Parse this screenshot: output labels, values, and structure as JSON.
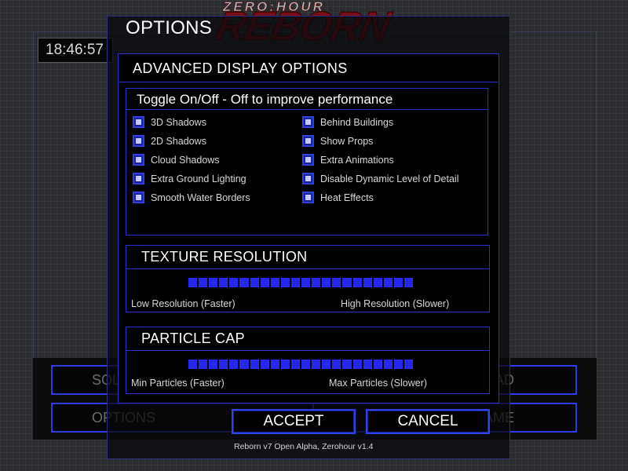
{
  "background_menu": {
    "clock": "18:46:57",
    "buttons": [
      {
        "label": "SOLO PLAY"
      },
      {
        "label": "LOAD"
      },
      {
        "label": "OPTIONS"
      },
      {
        "label": "EXIT GAME"
      }
    ]
  },
  "logo": {
    "top": "ZERO:HOUR",
    "main": "REBORN"
  },
  "dialog": {
    "title": "OPTIONS",
    "advanced_title": "ADVANCED DISPLAY OPTIONS",
    "toggle_section": {
      "title": "Toggle On/Off - Off to improve performance",
      "left_items": [
        {
          "label": "3D Shadows",
          "checked": true
        },
        {
          "label": "2D Shadows",
          "checked": true
        },
        {
          "label": "Cloud Shadows",
          "checked": true
        },
        {
          "label": "Extra Ground Lighting",
          "checked": true
        },
        {
          "label": "Smooth Water Borders",
          "checked": true
        }
      ],
      "right_items": [
        {
          "label": "Behind Buildings",
          "checked": true
        },
        {
          "label": "Show Props",
          "checked": true
        },
        {
          "label": "Extra Animations",
          "checked": true
        },
        {
          "label": "Disable Dynamic Level of Detail",
          "checked": true
        },
        {
          "label": "Heat Effects",
          "checked": true
        }
      ]
    },
    "texture": {
      "title": "TEXTURE RESOLUTION",
      "low_label": "Low Resolution (Faster)",
      "high_label": "High Resolution (Slower)",
      "level": 1.0
    },
    "particle": {
      "title": "PARTICLE CAP",
      "min_label": "Min Particles (Faster)",
      "max_label": "Max Particles (Slower)",
      "level": 1.0
    },
    "accept_label": "ACCEPT",
    "cancel_label": "CANCEL"
  },
  "footer": "Reborn v7 Open Alpha, Zerohour v1.4",
  "colors": {
    "accent_blue": "#2b31c8",
    "slider_blue": "#2828f4",
    "logo_red": "#7a0e10"
  }
}
